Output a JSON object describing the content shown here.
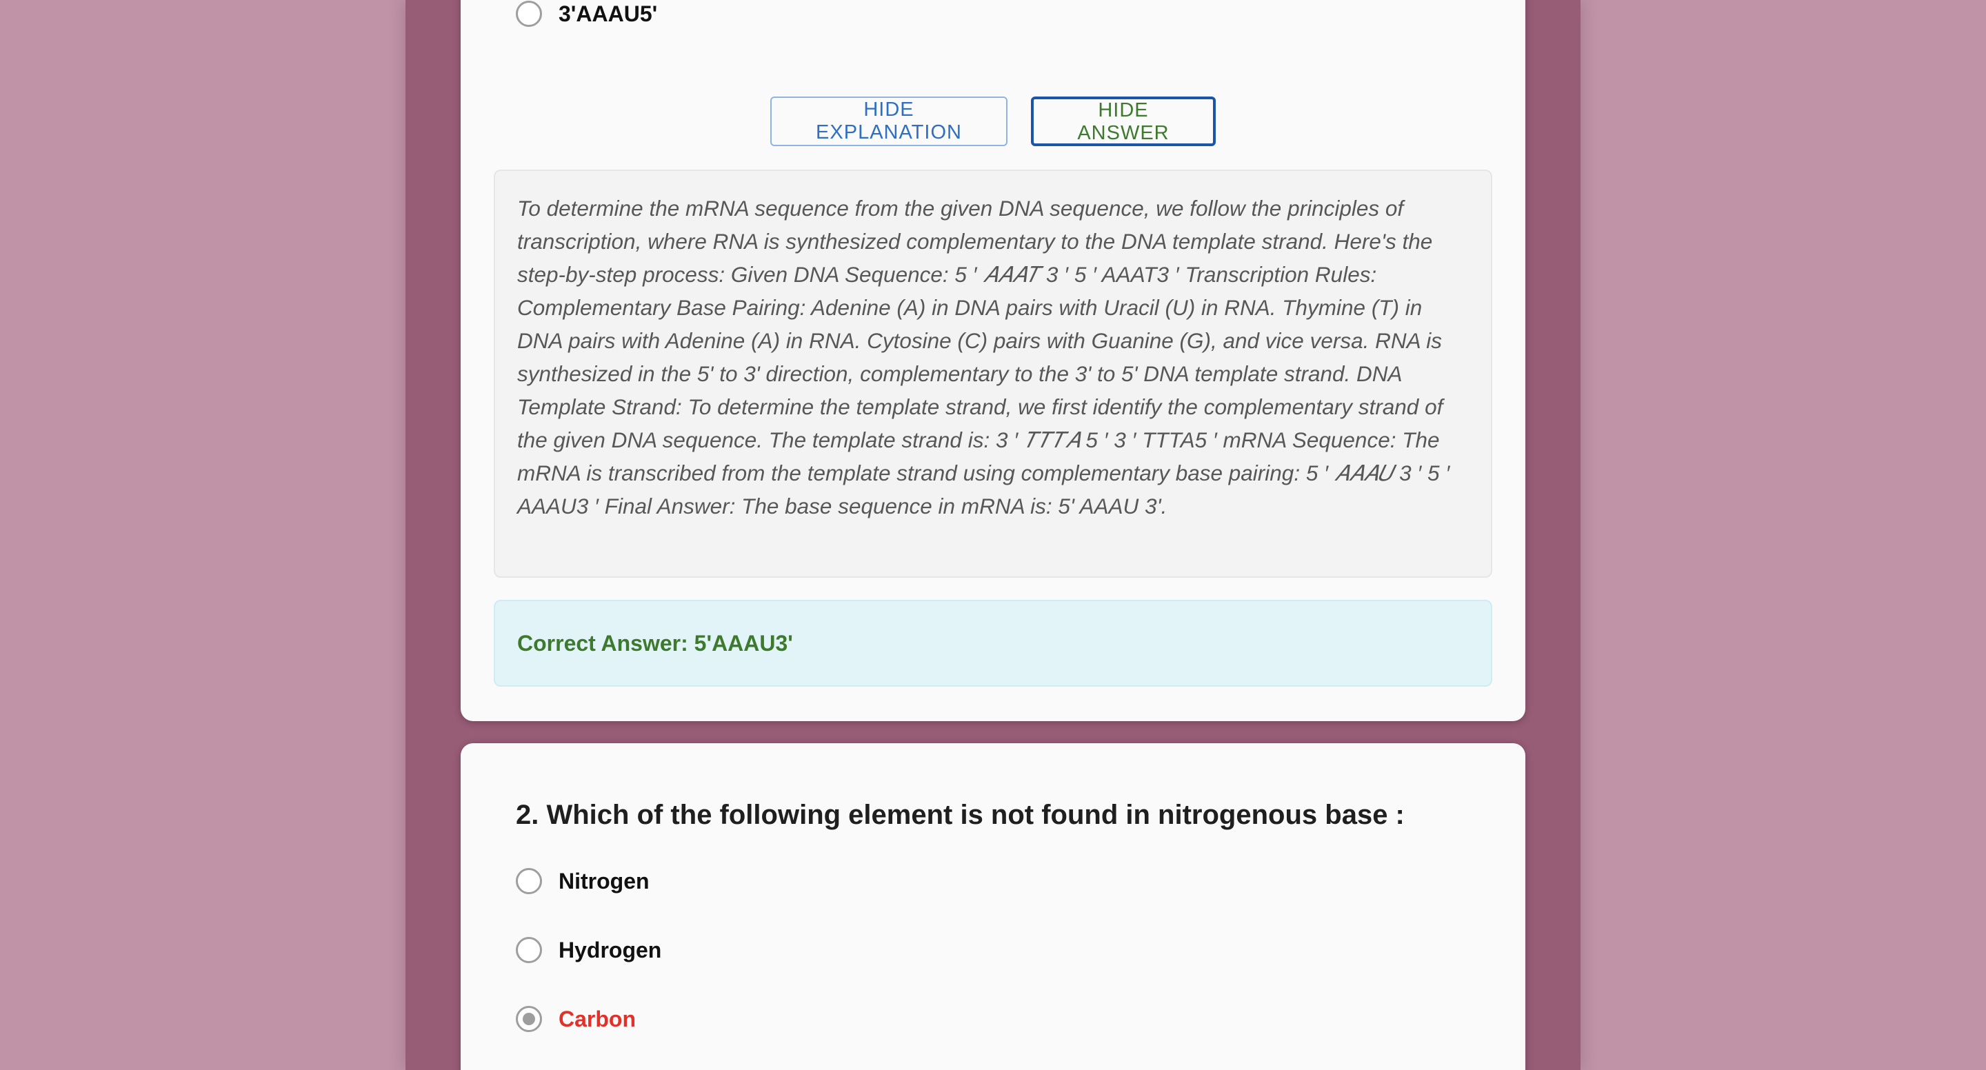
{
  "question1": {
    "visible_option": {
      "label": "3'AAAU5'",
      "selected": false
    },
    "buttons": {
      "hide_explanation": "HIDE EXPLANATION",
      "hide_answer": "HIDE ANSWER"
    },
    "explanation": "To determine the mRNA sequence from the given DNA sequence, we follow the principles of transcription, where RNA is synthesized complementary to the DNA template strand. Here's the step-by-step process: Given DNA Sequence: 5 ′ 𝐴𝐴𝐴𝑇 3 ′ 5 ′ AAAT3 ′ Transcription Rules: Complementary Base Pairing: Adenine (A) in DNA pairs with Uracil (U) in RNA. Thymine (T) in DNA pairs with Adenine (A) in RNA. Cytosine (C) pairs with Guanine (G), and vice versa. RNA is synthesized in the 5' to 3' direction, complementary to the 3' to 5' DNA template strand. DNA Template Strand: To determine the template strand, we first identify the complementary strand of the given DNA sequence. The template strand is: 3 ′ 𝑇𝑇𝑇𝐴 5 ′ 3 ′ TTTA5 ′ mRNA Sequence: The mRNA is transcribed from the template strand using complementary base pairing: 5 ′ 𝐴𝐴𝐴𝑈 3 ′ 5 ′ AAAU3 ′ Final Answer: The base sequence in mRNA is: 5' AAAU 3'.",
    "correct_answer": "Correct Answer: 5'AAAU3'"
  },
  "question2": {
    "title": "2. Which of the following element is not found in nitrogenous base :",
    "options": [
      {
        "label": "Nitrogen",
        "selected": false,
        "state": "default"
      },
      {
        "label": "Hydrogen",
        "selected": false,
        "state": "default"
      },
      {
        "label": "Carbon",
        "selected": true,
        "state": "incorrect"
      }
    ]
  },
  "colors": {
    "page_background": "#c093a6",
    "column_background": "#975c76",
    "card_background": "#fafafa",
    "incorrect_red": "#e0322a",
    "correct_green": "#3d7a2e",
    "button_blue": "#2e6fc4",
    "answer_box_bg": "#e2f4f8"
  }
}
